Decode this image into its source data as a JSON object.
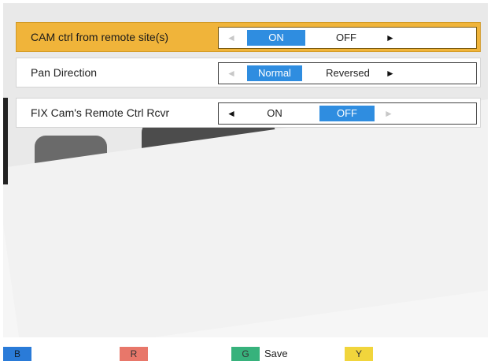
{
  "settings": [
    {
      "label": "CAM ctrl from remote site(s)",
      "left_arrow": "◄",
      "opt_a": "ON",
      "opt_b": "OFF",
      "right_arrow": "►"
    },
    {
      "label": "Pan Direction",
      "left_arrow": "◄",
      "opt_a": "Normal",
      "opt_b": "Reversed",
      "right_arrow": "►"
    },
    {
      "label": "FIX Cam's Remote Ctrl Rcvr",
      "left_arrow": "◄",
      "opt_a": "ON",
      "opt_b": "OFF",
      "right_arrow": "►"
    }
  ],
  "footer": {
    "blue_key": "B",
    "red_key": "R",
    "green_key": "G",
    "save_label": "Save",
    "yellow_key": "Y"
  },
  "colors": {
    "selected_row": "#f0b43a",
    "active_option": "#2f8de0"
  }
}
